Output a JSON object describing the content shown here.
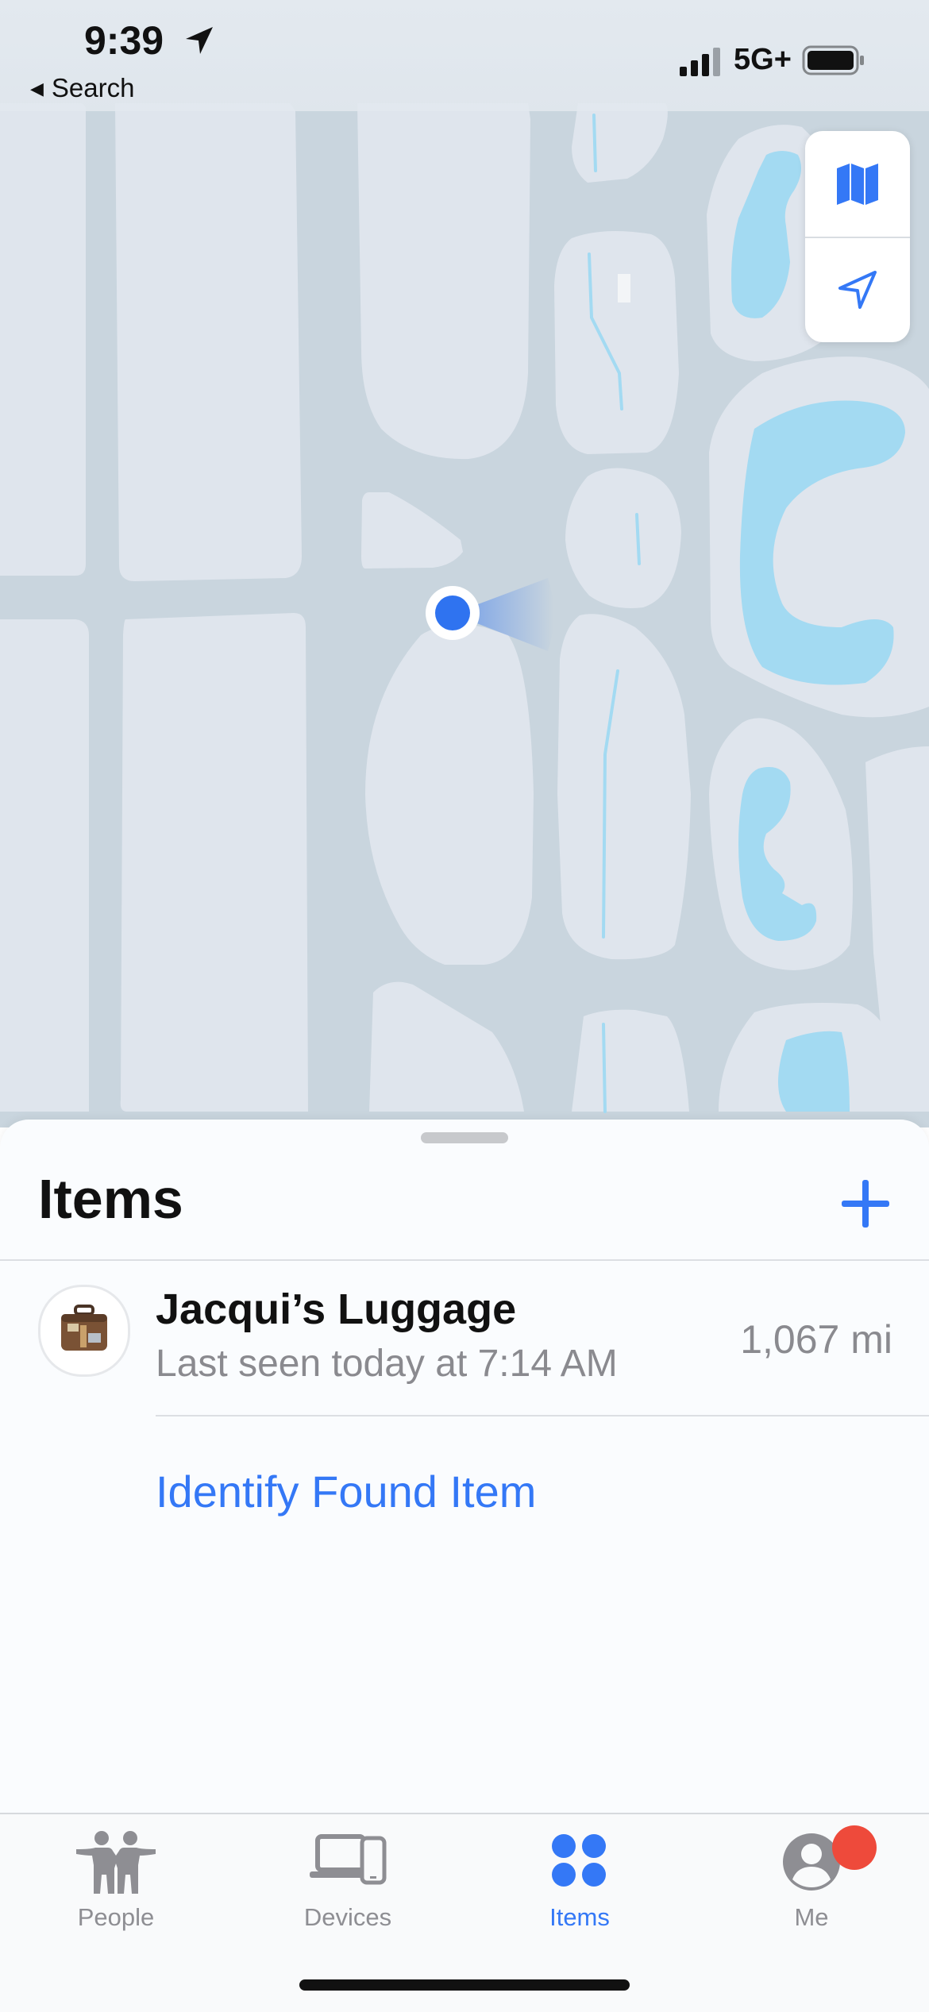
{
  "status_bar": {
    "time": "9:39",
    "back_label": "Search",
    "network": "5G+"
  },
  "map": {
    "controls": [
      "map-style-icon",
      "location-arrow-icon"
    ],
    "colors": {
      "land": "#dfe5ed",
      "road": "#c9d5de",
      "water": "#a3daf2",
      "user_dot": "#2f73f0"
    }
  },
  "sheet": {
    "title": "Items",
    "add_icon": "plus-icon",
    "items": [
      {
        "name": "Jacqui’s Luggage",
        "status": "Last seen today at 7:14 AM",
        "distance": "1,067 mi",
        "icon": "luggage-icon"
      }
    ],
    "identify_link": "Identify Found Item"
  },
  "tabbar": {
    "tabs": [
      {
        "label": "People",
        "icon": "people-icon"
      },
      {
        "label": "Devices",
        "icon": "devices-icon"
      },
      {
        "label": "Items",
        "icon": "items-icon",
        "active": true
      },
      {
        "label": "Me",
        "icon": "me-icon"
      }
    ]
  },
  "colors": {
    "accent": "#3478f6",
    "badge": "#ee4a3b"
  }
}
